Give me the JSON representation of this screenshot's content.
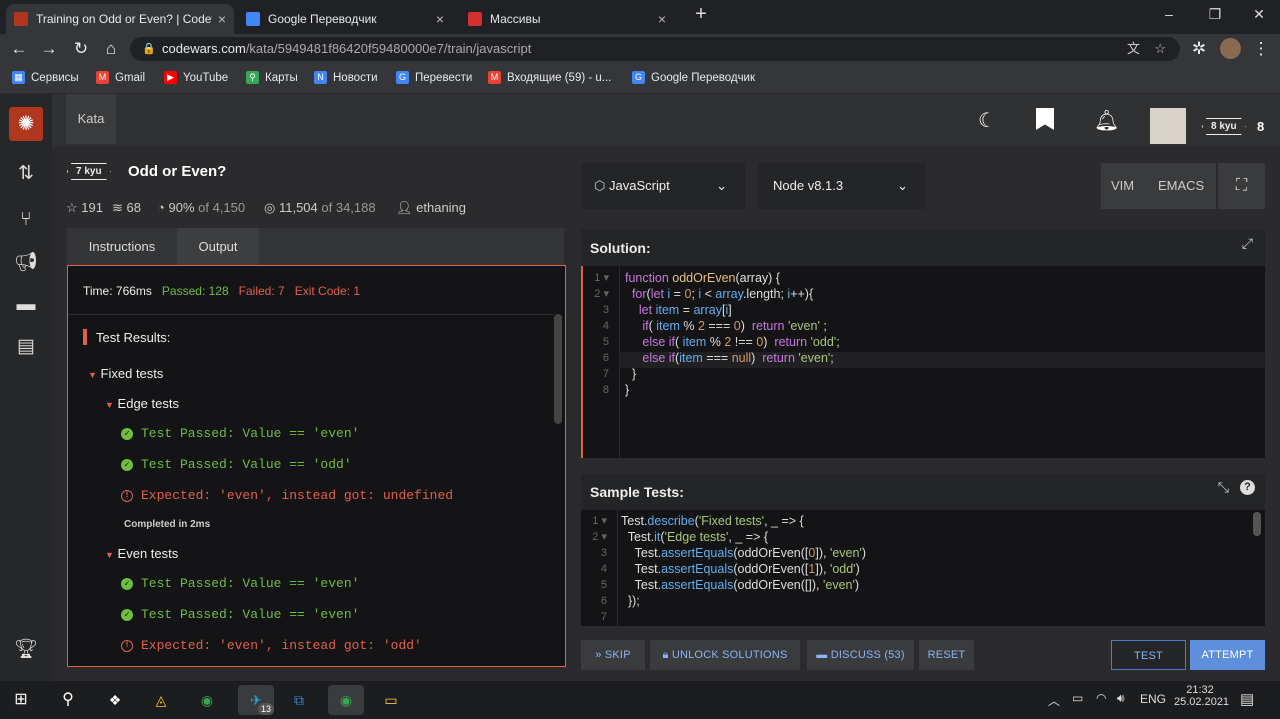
{
  "browser": {
    "tabs": [
      {
        "title": "Training on Odd or Even? | Codewars",
        "close": "×",
        "icon": "codewars-icon",
        "color": "#b1361e"
      },
      {
        "title": "Google Переводчик",
        "close": "×",
        "icon": "google-translate-icon",
        "color": "#4285f4"
      },
      {
        "title": "Массивы",
        "close": "×",
        "icon": "yandex-icon",
        "color": "#d32f2f"
      }
    ],
    "new_tab": "+",
    "window_controls": [
      "–",
      "❐",
      "✕"
    ],
    "url_host": "codewars.com",
    "url_path": "/kata/5949481f86420f59480000e7/train/javascript",
    "bookmarks": [
      {
        "label": "Сервисы",
        "icon": "apps-icon",
        "color": "#4285f4"
      },
      {
        "label": "Gmail",
        "icon": "gmail-icon",
        "color": "#ea4335"
      },
      {
        "label": "YouTube",
        "icon": "youtube-icon",
        "color": "#ff0000"
      },
      {
        "label": "Карты",
        "icon": "maps-icon",
        "color": "#34a853"
      },
      {
        "label": "Новости",
        "icon": "news-icon",
        "color": "#4285f4"
      },
      {
        "label": "Перевести",
        "icon": "translate-icon",
        "color": "#4285f4"
      },
      {
        "label": "Входящие (59) - u...",
        "icon": "gmail-icon",
        "color": "#ea4335"
      },
      {
        "label": "Google Переводчик",
        "icon": "google-translate-icon",
        "color": "#4285f4"
      }
    ]
  },
  "topbar": {
    "nav_label": "Kata",
    "rank": "8 kyu",
    "honor": "8"
  },
  "kata": {
    "rank": "7 kyu",
    "title": "Odd or Even?",
    "stars": "191",
    "collections": "68",
    "satisfaction_pct": "90%",
    "satisfaction_of": "of 4,150",
    "completed": "11,504",
    "completed_of": "of 34,188",
    "author": "ethaning"
  },
  "panel_tabs": {
    "instructions": "Instructions",
    "output": "Output"
  },
  "output": {
    "time": "Time: 766ms",
    "passed": "Passed: 128",
    "failed": "Failed: 7",
    "exit": "Exit Code: 1",
    "results_title": "Test Results:",
    "group1": "Fixed tests",
    "sub1": "Edge tests",
    "lines1": [
      "Test Passed: Value == 'even'",
      "Test Passed: Value == 'odd'",
      "Expected: 'even', instead got: undefined"
    ],
    "completed1": "Completed in 2ms",
    "sub2": "Even tests",
    "lines2": [
      "Test Passed: Value == 'even'",
      "Test Passed: Value == 'even'",
      "Expected: 'even', instead got: 'odd'"
    ]
  },
  "editor": {
    "language": "JavaScript",
    "runtime": "Node v8.1.3",
    "vim": "VIM",
    "emacs": "EMACS",
    "solution_title": "Solution:",
    "sample_title": "Sample Tests:",
    "solution_lines": [
      "function oddOrEven(array) {",
      "  for(let i = 0; i < array.length; i++){",
      "    let item = array[i]",
      "     if( item % 2 === 0)  return 'even' ;",
      "     else if( item % 2 !== 0)  return 'odd';",
      "     else if(item === null)  return 'even';",
      "  }",
      "}"
    ],
    "sample_lines": [
      "Test.describe('Fixed tests', _ => {",
      "  Test.it('Edge tests', _ => {",
      "    Test.assertEquals(oddOrEven([0]), 'even')",
      "    Test.assertEquals(oddOrEven([1]), 'odd')",
      "    Test.assertEquals(oddOrEven([]), 'even')",
      "  });",
      ""
    ]
  },
  "actions": {
    "skip": "SKIP",
    "unlock": "UNLOCK SOLUTIONS",
    "discuss": "DISCUSS (53)",
    "reset": "RESET",
    "test": "TEST",
    "attempt": "ATTEMPT"
  },
  "taskbar": {
    "lang": "ENG",
    "time": "21:32",
    "date": "25.02.2021",
    "telegram_badge": "13"
  }
}
